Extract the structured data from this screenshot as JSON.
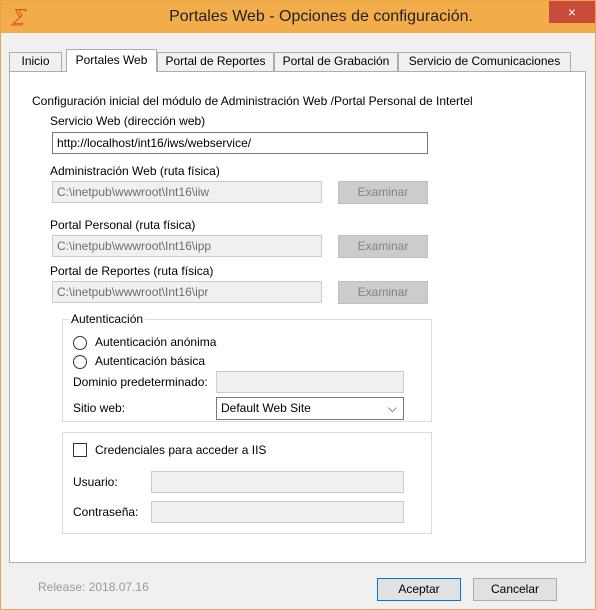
{
  "window": {
    "title": "Portales Web - Opciones de configuración.",
    "close_glyph": "×",
    "icon_name": "app-logo-icon"
  },
  "tabs": [
    {
      "label": "Inicio",
      "active": false
    },
    {
      "label": "Portales Web",
      "active": true
    },
    {
      "label": "Portal de Reportes",
      "active": false
    },
    {
      "label": "Portal de Grabación",
      "active": false
    },
    {
      "label": "Servicio de Comunicaciones",
      "active": false
    }
  ],
  "panel": {
    "intro": "Configuración inicial del módulo de Administración Web /Portal Personal de Intertel",
    "servicio_web": {
      "label": "Servicio Web (dirección web)",
      "value": "http://localhost/int16/iws/webservice/"
    },
    "admin_web": {
      "label": "Administración Web (ruta física)",
      "value": "C:\\inetpub\\wwwroot\\Int16\\iiw",
      "button": "Examinar"
    },
    "portal_personal": {
      "label": "Portal Personal (ruta física)",
      "value": "C:\\inetpub\\wwwroot\\Int16\\ipp",
      "button": "Examinar"
    },
    "portal_reportes": {
      "label": "Portal de Reportes (ruta física)",
      "value": "C:\\inetpub\\wwwroot\\Int16\\ipr",
      "button": "Examinar"
    },
    "auth": {
      "title": "Autenticación",
      "anonymous": "Autenticación anónima",
      "basic": "Autenticación básica",
      "domain_label": "Dominio predeterminado:",
      "domain_value": "",
      "site_label": "Sitio web:",
      "site_value": "Default Web Site"
    },
    "iis": {
      "checkbox_label": "Credenciales para acceder a IIS",
      "checked": false,
      "user_label": "Usuario:",
      "user_value": "",
      "password_label": "Contraseña:",
      "password_value": ""
    }
  },
  "footer": {
    "release": "Release: 2018.07.16",
    "accept": "Aceptar",
    "cancel": "Cancelar"
  },
  "colors": {
    "titlebar": "#f2ad4a",
    "close": "#c84b3b",
    "window_bg": "#f0f0f0",
    "panel_bg": "#ffffff"
  }
}
